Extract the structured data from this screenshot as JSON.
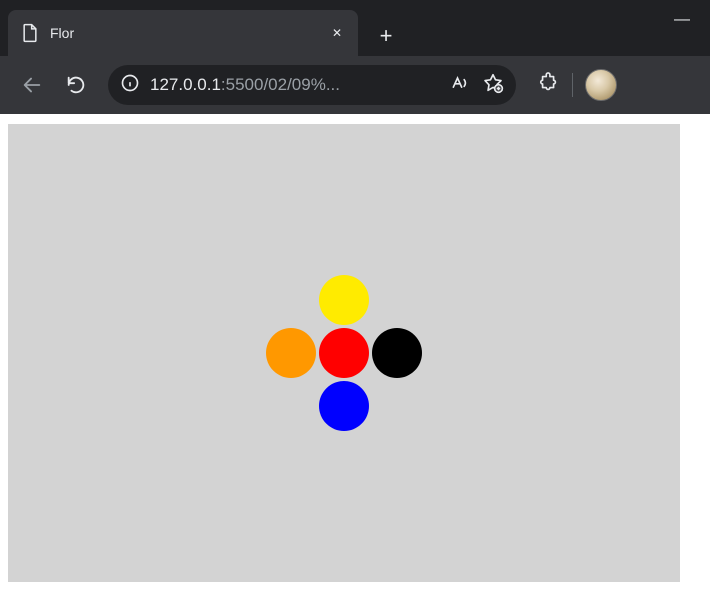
{
  "browser": {
    "tab_title": "Flor",
    "url_host": "127.0.0.1",
    "url_path": ":5500/02/09%...",
    "new_tab_glyph": "+",
    "close_glyph": "✕",
    "minimize_glyph": "—"
  },
  "flower": {
    "petals": [
      {
        "position": "top",
        "color": "#ffeb00"
      },
      {
        "position": "right",
        "color": "#000000"
      },
      {
        "position": "bottom",
        "color": "#0000ff"
      },
      {
        "position": "left",
        "color": "#ff9800"
      },
      {
        "position": "center",
        "color": "#ff0000"
      }
    ]
  }
}
